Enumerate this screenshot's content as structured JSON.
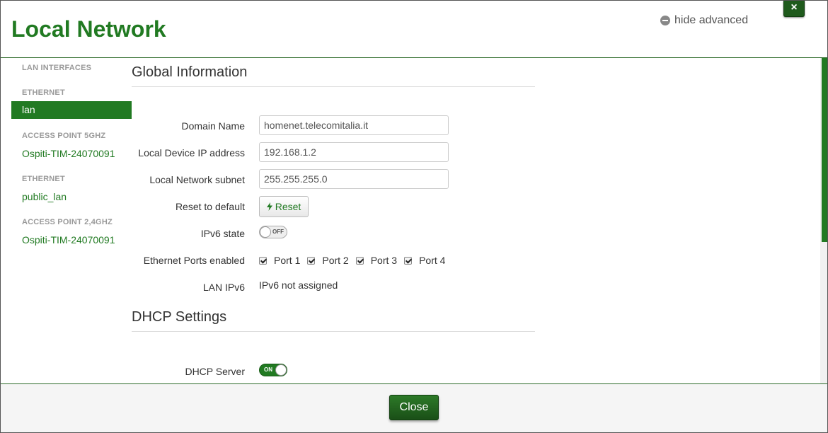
{
  "header": {
    "title": "Local Network",
    "advanced_toggle": "hide advanced",
    "close_x": "×"
  },
  "sidebar": {
    "items": [
      {
        "type": "heading",
        "label": "LAN INTERFACES"
      },
      {
        "type": "heading",
        "label": "ETHERNET"
      },
      {
        "type": "item",
        "label": "lan",
        "active": true
      },
      {
        "type": "heading",
        "label": "ACCESS POINT 5GHZ"
      },
      {
        "type": "item",
        "label": "Ospiti-TIM-24070091"
      },
      {
        "type": "heading",
        "label": "ETHERNET"
      },
      {
        "type": "item",
        "label": "public_lan"
      },
      {
        "type": "heading",
        "label": "ACCESS POINT 2,4GHZ"
      },
      {
        "type": "item",
        "label": "Ospiti-TIM-24070091"
      }
    ]
  },
  "global": {
    "title": "Global Information",
    "domain_name": {
      "label": "Domain Name",
      "value": "homenet.telecomitalia.it"
    },
    "local_ip": {
      "label": "Local Device IP address",
      "value": "192.168.1.2"
    },
    "subnet": {
      "label": "Local Network subnet",
      "value": "255.255.255.0"
    },
    "reset": {
      "label": "Reset to default",
      "button": "Reset"
    },
    "ipv6_state": {
      "label": "IPv6 state",
      "toggle": "OFF"
    },
    "ports": {
      "label": "Ethernet Ports enabled",
      "items": [
        "Port 1",
        "Port 2",
        "Port 3",
        "Port 4"
      ]
    },
    "lan_ipv6": {
      "label": "LAN IPv6",
      "value": "IPv6 not assigned"
    }
  },
  "dhcp": {
    "title": "DHCP Settings",
    "server": {
      "label": "DHCP Server",
      "toggle": "ON"
    }
  },
  "footer": {
    "close_label": "Close"
  },
  "colors": {
    "accent": "#217a22",
    "dark_accent": "#1a4f17"
  }
}
